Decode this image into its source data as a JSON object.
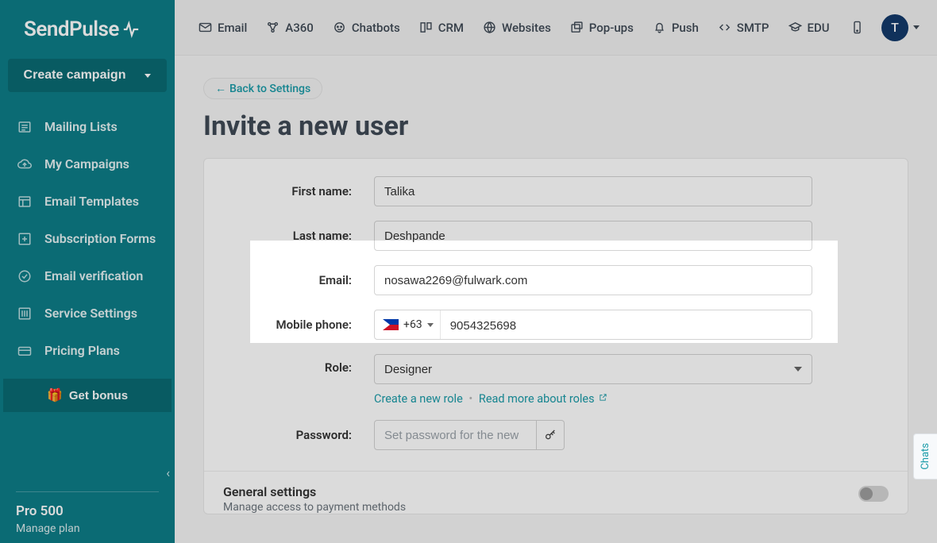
{
  "brand": "SendPulse",
  "sidebar": {
    "create_label": "Create campaign",
    "items": [
      {
        "label": "Mailing Lists"
      },
      {
        "label": "My Campaigns"
      },
      {
        "label": "Email Templates"
      },
      {
        "label": "Subscription Forms"
      },
      {
        "label": "Email verification"
      },
      {
        "label": "Service Settings"
      },
      {
        "label": "Pricing Plans"
      }
    ],
    "bonus_label": "Get bonus",
    "plan_name": "Pro 500",
    "manage_plan": "Manage plan"
  },
  "topnav": {
    "items": [
      {
        "label": "Email"
      },
      {
        "label": "A360"
      },
      {
        "label": "Chatbots"
      },
      {
        "label": "CRM"
      },
      {
        "label": "Websites"
      },
      {
        "label": "Pop-ups"
      },
      {
        "label": "Push"
      },
      {
        "label": "SMTP"
      },
      {
        "label": "EDU"
      }
    ],
    "avatar_initial": "T"
  },
  "page": {
    "back_label": "Back to Settings",
    "title": "Invite a new user"
  },
  "form": {
    "first_name_label": "First name:",
    "first_name_value": "Talika",
    "last_name_label": "Last name:",
    "last_name_value": "Deshpande",
    "email_label": "Email:",
    "email_value": "nosawa2269@fulwark.com",
    "phone_label": "Mobile phone:",
    "phone_cc": "+63",
    "phone_value": "9054325698",
    "role_label": "Role:",
    "role_value": "Designer",
    "create_role_link": "Create a new role",
    "read_more_link": "Read more about roles",
    "password_label": "Password:",
    "password_placeholder": "Set password for the new"
  },
  "section": {
    "title": "General settings",
    "subtitle": "Manage access to payment methods"
  },
  "chats_tab": "Chats"
}
